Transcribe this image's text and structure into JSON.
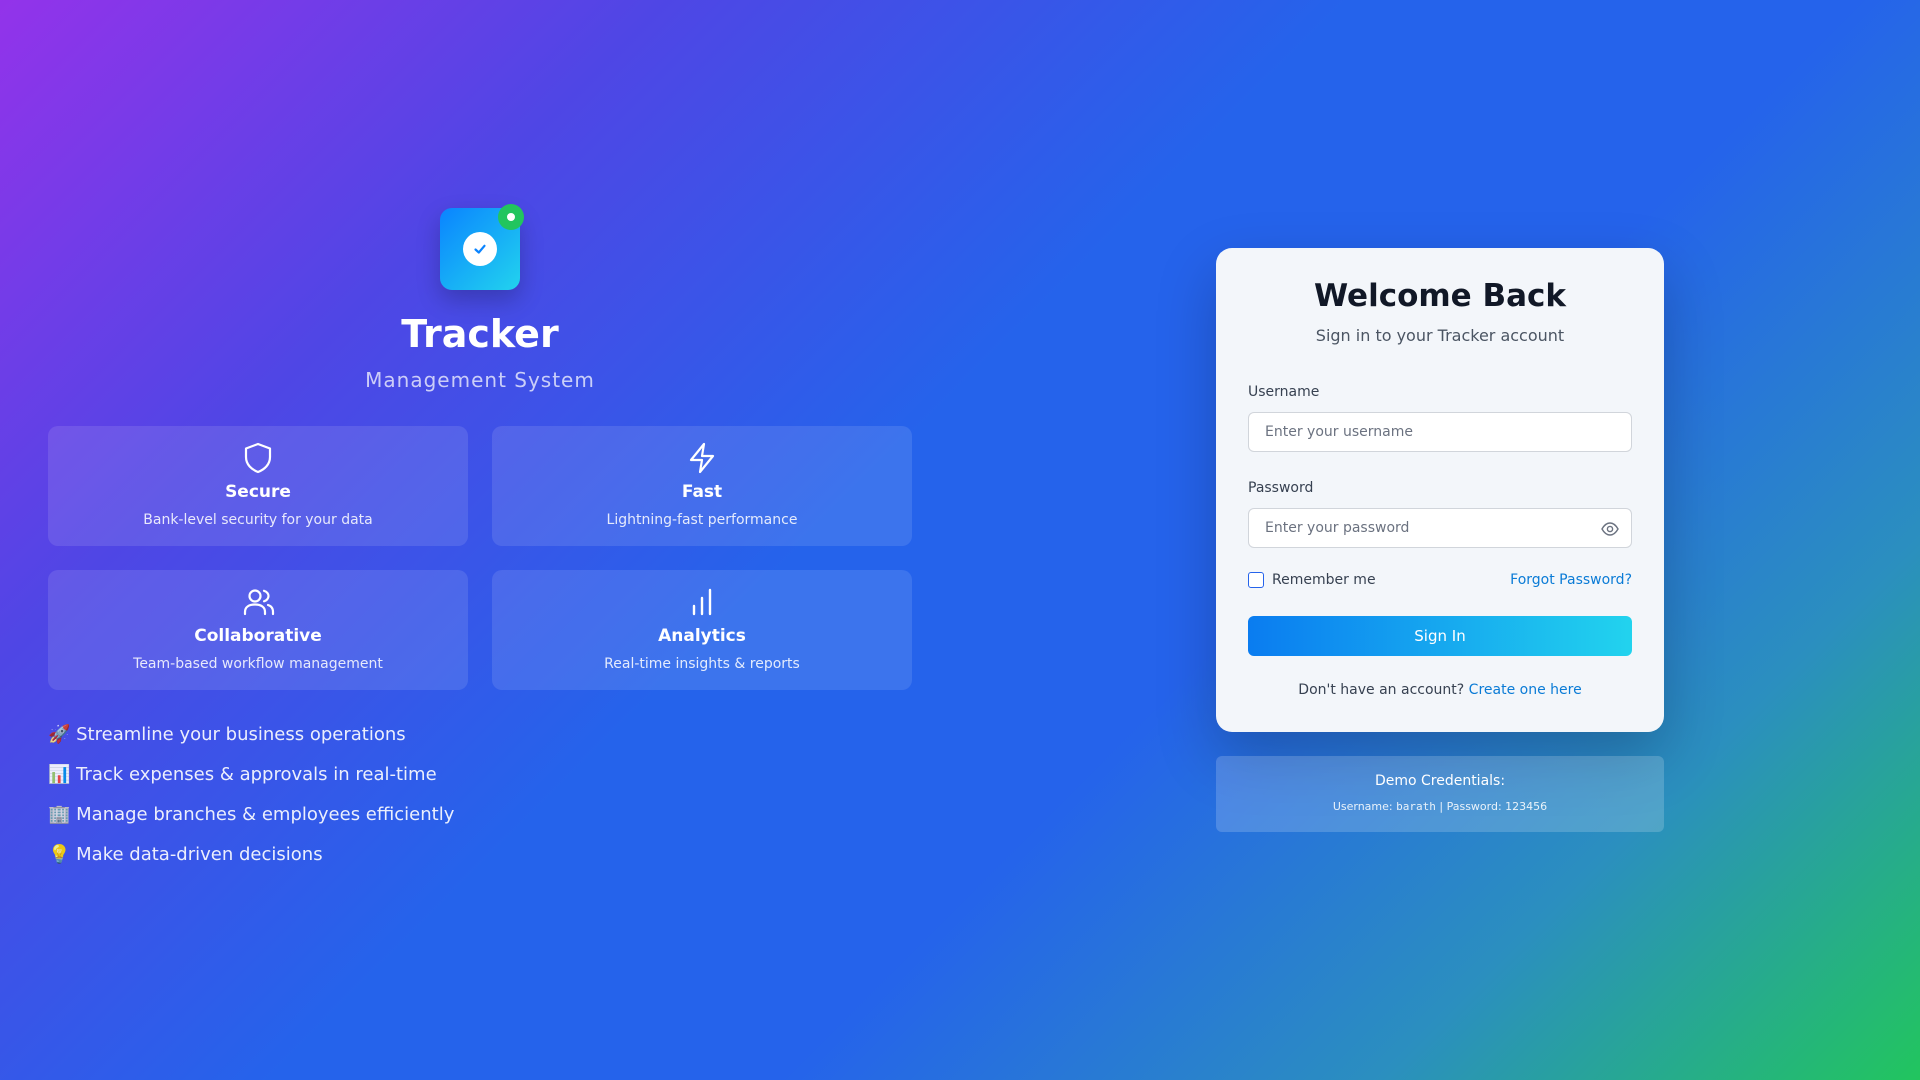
{
  "brand": {
    "title": "Tracker",
    "subtitle": "Management System",
    "logo_icon": "check-circle-icon",
    "accent": "#0a84ff",
    "status_dot_color": "#22c55e"
  },
  "features": [
    {
      "icon": "shield-icon",
      "title": "Secure",
      "desc": "Bank-level security for your data"
    },
    {
      "icon": "lightning-icon",
      "title": "Fast",
      "desc": "Lightning-fast performance"
    },
    {
      "icon": "users-icon",
      "title": "Collaborative",
      "desc": "Team-based workflow management"
    },
    {
      "icon": "bar-chart-icon",
      "title": "Analytics",
      "desc": "Real-time insights & reports"
    }
  ],
  "bullets": [
    "🚀 Streamline your business operations",
    "📊 Track expenses & approvals in real-time",
    "🏢 Manage branches & employees efficiently",
    "💡 Make data-driven decisions"
  ],
  "login": {
    "title": "Welcome Back",
    "subtitle": "Sign in to your Tracker account",
    "username_label": "Username",
    "username_placeholder": "Enter your username",
    "username_value": "",
    "password_label": "Password",
    "password_placeholder": "Enter your password",
    "password_value": "",
    "remember_label": "Remember me",
    "remember_checked": false,
    "forgot_label": "Forgot Password?",
    "submit_label": "Sign In",
    "signup_prompt": "Don't have an account?",
    "signup_link": "Create one here"
  },
  "demo": {
    "title": "Demo Credentials:",
    "username_prefix": "Username:",
    "username": "barath",
    "separator": "|",
    "password_prefix": "Password:",
    "password": "123456"
  }
}
